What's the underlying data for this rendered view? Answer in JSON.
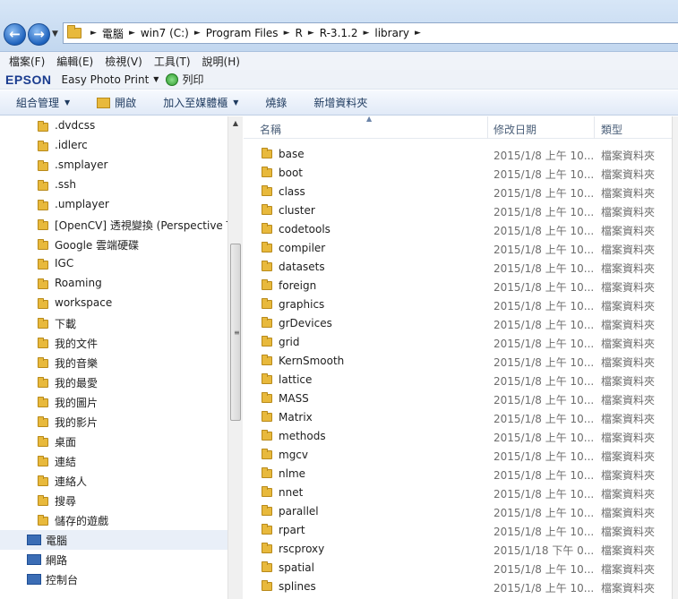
{
  "address": {
    "crumbs": [
      "電腦",
      "win7 (C:)",
      "Program Files",
      "R",
      "R-3.1.2",
      "library"
    ]
  },
  "menu": [
    "檔案(F)",
    "編輯(E)",
    "檢視(V)",
    "工具(T)",
    "說明(H)"
  ],
  "epson": {
    "logo": "EPSON",
    "app": "Easy Photo Print",
    "print": "列印"
  },
  "commands": {
    "organize": "組合管理",
    "open": "開啟",
    "add_library": "加入至媒體櫃",
    "burn": "燒錄",
    "new_folder": "新增資料夾"
  },
  "nav": [
    {
      "label": ".dvdcss"
    },
    {
      "label": ".idlerc"
    },
    {
      "label": ".smplayer"
    },
    {
      "label": ".ssh"
    },
    {
      "label": ".umplayer"
    },
    {
      "label": "[OpenCV] 透視變換 (Perspective Tr"
    },
    {
      "label": "Google 雲端硬碟"
    },
    {
      "label": "IGC"
    },
    {
      "label": "Roaming"
    },
    {
      "label": "workspace"
    },
    {
      "label": "下載"
    },
    {
      "label": "我的文件"
    },
    {
      "label": "我的音樂"
    },
    {
      "label": "我的最愛"
    },
    {
      "label": "我的圖片"
    },
    {
      "label": "我的影片"
    },
    {
      "label": "桌面"
    },
    {
      "label": "連結"
    },
    {
      "label": "連絡人"
    },
    {
      "label": "搜尋"
    },
    {
      "label": "儲存的遊戲"
    },
    {
      "label": "電腦"
    },
    {
      "label": "網路"
    },
    {
      "label": "控制台"
    }
  ],
  "columns": {
    "name": "名稱",
    "date": "修改日期",
    "type": "類型"
  },
  "files": [
    {
      "name": "base",
      "date": "2015/1/8 上午 10...",
      "type": "檔案資料夾"
    },
    {
      "name": "boot",
      "date": "2015/1/8 上午 10...",
      "type": "檔案資料夾"
    },
    {
      "name": "class",
      "date": "2015/1/8 上午 10...",
      "type": "檔案資料夾"
    },
    {
      "name": "cluster",
      "date": "2015/1/8 上午 10...",
      "type": "檔案資料夾"
    },
    {
      "name": "codetools",
      "date": "2015/1/8 上午 10...",
      "type": "檔案資料夾"
    },
    {
      "name": "compiler",
      "date": "2015/1/8 上午 10...",
      "type": "檔案資料夾"
    },
    {
      "name": "datasets",
      "date": "2015/1/8 上午 10...",
      "type": "檔案資料夾"
    },
    {
      "name": "foreign",
      "date": "2015/1/8 上午 10...",
      "type": "檔案資料夾"
    },
    {
      "name": "graphics",
      "date": "2015/1/8 上午 10...",
      "type": "檔案資料夾"
    },
    {
      "name": "grDevices",
      "date": "2015/1/8 上午 10...",
      "type": "檔案資料夾"
    },
    {
      "name": "grid",
      "date": "2015/1/8 上午 10...",
      "type": "檔案資料夾"
    },
    {
      "name": "KernSmooth",
      "date": "2015/1/8 上午 10...",
      "type": "檔案資料夾"
    },
    {
      "name": "lattice",
      "date": "2015/1/8 上午 10...",
      "type": "檔案資料夾"
    },
    {
      "name": "MASS",
      "date": "2015/1/8 上午 10...",
      "type": "檔案資料夾"
    },
    {
      "name": "Matrix",
      "date": "2015/1/8 上午 10...",
      "type": "檔案資料夾"
    },
    {
      "name": "methods",
      "date": "2015/1/8 上午 10...",
      "type": "檔案資料夾"
    },
    {
      "name": "mgcv",
      "date": "2015/1/8 上午 10...",
      "type": "檔案資料夾"
    },
    {
      "name": "nlme",
      "date": "2015/1/8 上午 10...",
      "type": "檔案資料夾"
    },
    {
      "name": "nnet",
      "date": "2015/1/8 上午 10...",
      "type": "檔案資料夾"
    },
    {
      "name": "parallel",
      "date": "2015/1/8 上午 10...",
      "type": "檔案資料夾"
    },
    {
      "name": "rpart",
      "date": "2015/1/8 上午 10...",
      "type": "檔案資料夾"
    },
    {
      "name": "rscproxy",
      "date": "2015/1/18 下午 0...",
      "type": "檔案資料夾"
    },
    {
      "name": "spatial",
      "date": "2015/1/8 上午 10...",
      "type": "檔案資料夾"
    },
    {
      "name": "splines",
      "date": "2015/1/8 上午 10...",
      "type": "檔案資料夾"
    }
  ]
}
